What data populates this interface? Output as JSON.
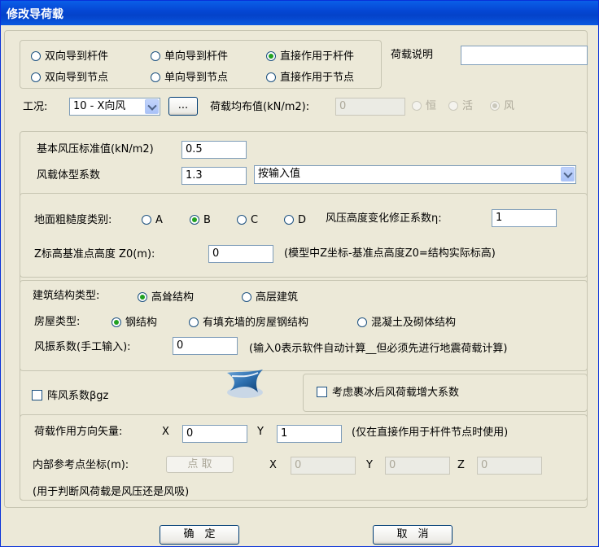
{
  "window": {
    "title": "修改导荷载"
  },
  "direction": {
    "options": [
      "双向导到杆件",
      "单向导到杆件",
      "直接作用于杆件",
      "双向导到节点",
      "单向导到节点",
      "直接作用于节点"
    ],
    "selected": "直接作用于杆件"
  },
  "load_desc": {
    "label": "荷载说明",
    "value": ""
  },
  "case": {
    "label": "工况:",
    "value": "10 - X向风",
    "more_label": "...",
    "dist_label": "荷载均布值(kN/m2):",
    "dist_value": "0",
    "types": [
      "恒",
      "活",
      "风"
    ],
    "selected_type": "风"
  },
  "wind": {
    "pressure_label": "基本风压标准值(kN/m2)",
    "pressure_value": "0.5",
    "shape_label": "风载体型系数",
    "shape_value": "1.3",
    "shape_mode": "按输入值"
  },
  "terrain": {
    "label": "地面粗糙度类别:",
    "options": [
      "A",
      "B",
      "C",
      "D"
    ],
    "selected": "B",
    "eta_label": "风压高度变化修正系数η:",
    "eta_value": "1",
    "z0_label": "Z标高基准点高度 Z0(m):",
    "z0_value": "0",
    "z0_note": "(模型中Z坐标-基准点高度Z0=结构实际标高)"
  },
  "structure": {
    "type_label": "建筑结构类型:",
    "type_options": [
      "高耸结构",
      "高层建筑"
    ],
    "type_selected": "高耸结构",
    "house_label": "房屋类型:",
    "house_options": [
      "钢结构",
      "有填充墙的房屋钢结构",
      "混凝土及砌体结构"
    ],
    "house_selected": "钢结构",
    "vib_label": "风振系数(手工输入):",
    "vib_value": "0",
    "vib_note": "(输入0表示软件自动计算__但必须先进行地震荷载计算)"
  },
  "gust": {
    "label": "阵风系数βgz",
    "checked": false
  },
  "ice": {
    "label": "考虑裹冰后风荷载增大系数",
    "checked": false
  },
  "vector": {
    "label": "荷载作用方向矢量:",
    "x_label": "X",
    "x_value": "0",
    "y_label": "Y",
    "y_value": "1",
    "note": "(仅在直接作用于杆件节点时使用)"
  },
  "ref_point": {
    "label": "内部参考点坐标(m):",
    "pick_label": "点 取",
    "x_label": "X",
    "x_value": "0",
    "y_label": "Y",
    "y_value": "0",
    "z_label": "Z",
    "z_value": "0",
    "note": "(用于判断风荷载是风压还是风吸)"
  },
  "buttons": {
    "ok": "确　定",
    "cancel": "取　消"
  },
  "colors": {
    "title_bar": "#0A5FE8",
    "face": "#ECE9D8",
    "radio_dot": "#21A121"
  },
  "icons": [
    "radio-icon",
    "checkbox-icon",
    "dropdown-arrow-icon",
    "wind-logo-icon"
  ]
}
